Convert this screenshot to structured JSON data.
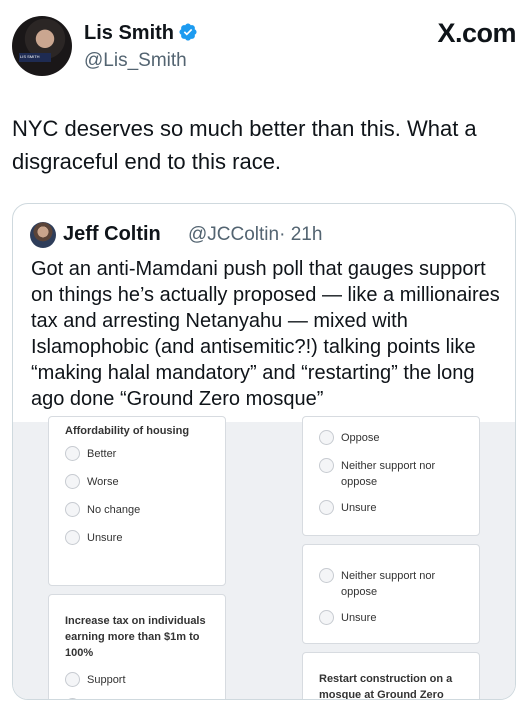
{
  "author": {
    "display_name": "Lis Smith",
    "handle": "@Lis_Smith",
    "avatar_caption": "LIS SMITH"
  },
  "site": "X.com",
  "tweet_text": "NYC deserves so much better than this. What a disgraceful end to this race.",
  "quoted": {
    "display_name": "Jeff Coltin",
    "handle": "@JCColtin",
    "time": "· 21h",
    "text": "Got an anti-Mamdani push poll that gauges support on things he’s actually proposed — like a millionaires tax and arresting Netanyahu — mixed with Islamophobic (and antisemitic?!) talking points like “making halal mandatory” and “restarting” the long ago done “Ground Zero mosque”"
  },
  "poll": {
    "left": {
      "card1_title": "Affordability of housing",
      "card1_options": [
        "Better",
        "Worse",
        "No change",
        "Unsure"
      ],
      "card2_title": "Increase tax on individuals earning more than $1m to 100%",
      "card2_options": [
        "Support"
      ]
    },
    "right": {
      "card1_options": [
        "Oppose",
        "Neither support nor oppose",
        "Unsure"
      ],
      "card2_options": [
        "Neither support nor oppose",
        "Unsure"
      ],
      "card3_title": "Restart construction on a mosque at Ground Zero"
    }
  },
  "colors": {
    "verified": "#1d9bf0",
    "secondary_text": "#536471"
  }
}
